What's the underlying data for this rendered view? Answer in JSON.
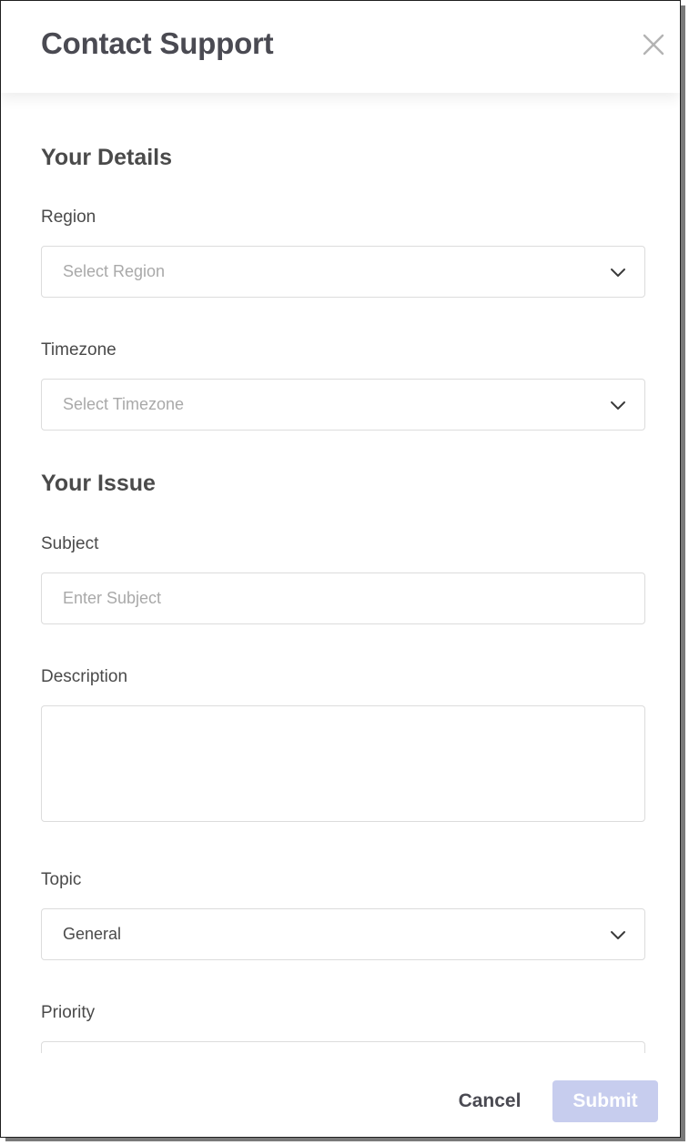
{
  "modal": {
    "title": "Contact Support",
    "close_icon": "close-icon"
  },
  "details": {
    "section_title": "Your Details",
    "region": {
      "label": "Region",
      "placeholder": "Select Region"
    },
    "timezone": {
      "label": "Timezone",
      "placeholder": "Select Timezone"
    }
  },
  "issue": {
    "section_title": "Your Issue",
    "subject": {
      "label": "Subject",
      "placeholder": "Enter Subject"
    },
    "description": {
      "label": "Description",
      "value": ""
    },
    "topic": {
      "label": "Topic",
      "value": "General"
    },
    "priority": {
      "label": "Priority"
    }
  },
  "footer": {
    "cancel_label": "Cancel",
    "submit_label": "Submit"
  },
  "colors": {
    "submit_disabled": "#c7cdee",
    "text_primary": "#4a4a52",
    "placeholder": "#a9a9a9",
    "border": "#dcdcdc"
  }
}
